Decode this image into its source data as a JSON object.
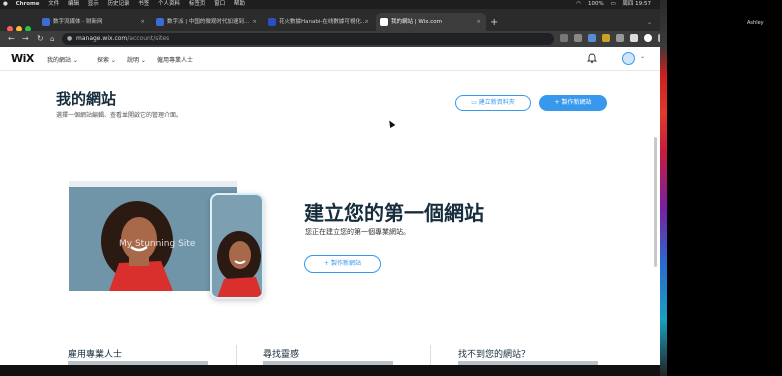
{
  "menubar": {
    "app": "Chrome",
    "items": [
      "文件",
      "编辑",
      "显示",
      "历史记录",
      "书签",
      "个人资料",
      "标签页",
      "窗口",
      "帮助"
    ],
    "battery": "100%",
    "clock": "周四 19:57"
  },
  "tabs": [
    {
      "title": "数字流媒体 - 财新网"
    },
    {
      "title": "数字派 | 中国的微观时代加速到..."
    },
    {
      "title": "花火數據Hanabi-在线數據可視化..."
    },
    {
      "title": "我的網站 | Wix.com"
    }
  ],
  "browser": {
    "domain": "manage.wix.com",
    "path": "/account/sites"
  },
  "wix_nav": {
    "logo": "WiX",
    "items": [
      "我的網站",
      "探索",
      "說明",
      "僱用專業人士"
    ]
  },
  "header": {
    "title": "我的網站",
    "subtitle": "選擇一個網站編輯、查看並開啟它的管理介面。",
    "new_folder": "建立新資料夾",
    "create_site": "製作新網站"
  },
  "hero": {
    "illustration_text": "My Stunning Site",
    "title": "建立您的第一個網站",
    "subtitle": "您正在建立您的第一個專業網站。",
    "button": "製作新網站"
  },
  "footer": {
    "columns": [
      "雇用專業人士",
      "尋找靈感",
      "找不到您的網站？"
    ]
  },
  "side": {
    "user": "Ashley"
  },
  "colors": {
    "wix_blue": "#3899ec",
    "heading": "#162d3d"
  }
}
